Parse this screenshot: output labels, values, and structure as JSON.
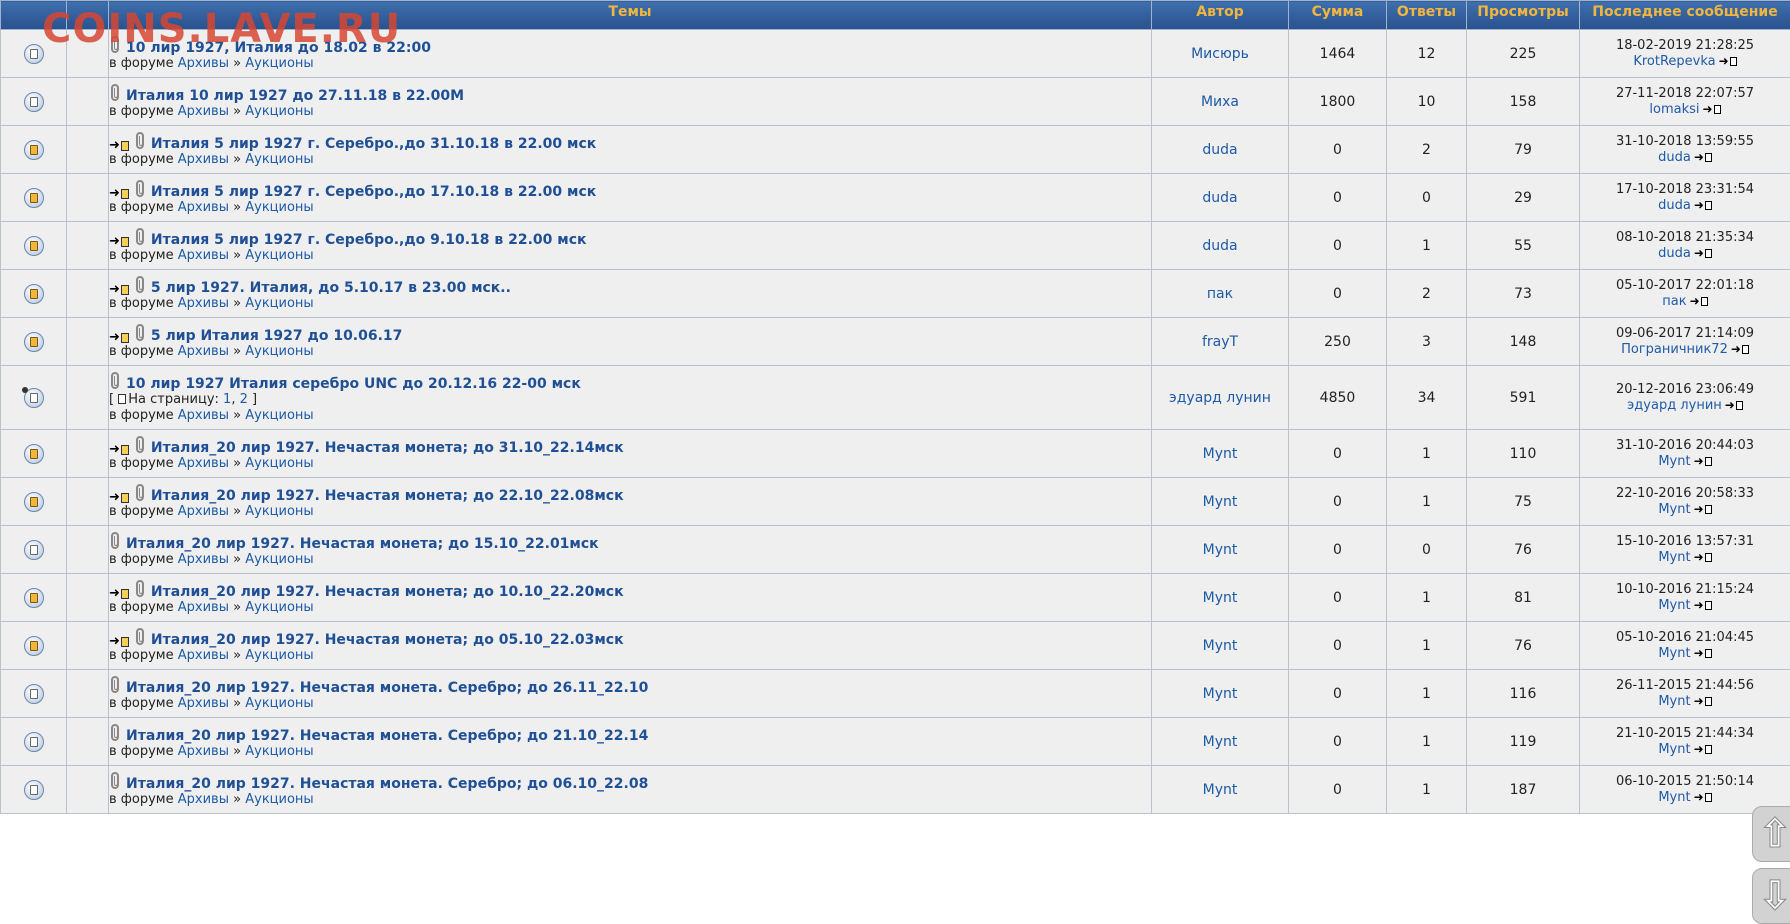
{
  "watermark": "COINS.LAVE.RU",
  "headers": {
    "topics": "Темы",
    "author": "Автор",
    "sum": "Сумма",
    "replies": "Ответы",
    "views": "Просмотры",
    "last": "Последнее сообщение"
  },
  "labels": {
    "in_forum": "в форуме",
    "separator": "»",
    "pages_prefix": "На страницу:"
  },
  "rows": [
    {
      "title": "10 лир 1927, Италия до 18.02 в 22:00",
      "new": false,
      "icon": "cold",
      "forum": "Архивы",
      "subforum": "Аукционы",
      "author": "Мисюрь",
      "sum": "1464",
      "replies": "12",
      "views": "225",
      "last_date": "18-02-2019 21:28:25",
      "last_user": "KrotRepevka"
    },
    {
      "title": "Италия 10 лир 1927 до 27.11.18 в 22.00М",
      "new": false,
      "icon": "cold",
      "forum": "Архивы",
      "subforum": "Аукционы",
      "author": "Миха",
      "sum": "1800",
      "replies": "10",
      "views": "158",
      "last_date": "27-11-2018 22:07:57",
      "last_user": "lomaksi"
    },
    {
      "title": "Италия 5 лир 1927 г. Серебро.,до 31.10.18 в 22.00 мск",
      "new": true,
      "icon": "hot",
      "forum": "Архивы",
      "subforum": "Аукционы",
      "author": "duda",
      "sum": "0",
      "replies": "2",
      "views": "79",
      "last_date": "31-10-2018 13:59:55",
      "last_user": "duda"
    },
    {
      "title": "Италия 5 лир 1927 г. Серебро.,до 17.10.18 в 22.00 мск",
      "new": true,
      "icon": "hot",
      "forum": "Архивы",
      "subforum": "Аукционы",
      "author": "duda",
      "sum": "0",
      "replies": "0",
      "views": "29",
      "last_date": "17-10-2018 23:31:54",
      "last_user": "duda"
    },
    {
      "title": "Италия 5 лир 1927 г. Серебро.,до 9.10.18 в 22.00 мск",
      "new": true,
      "icon": "hot",
      "forum": "Архивы",
      "subforum": "Аукционы",
      "author": "duda",
      "sum": "0",
      "replies": "1",
      "views": "55",
      "last_date": "08-10-2018 21:35:34",
      "last_user": "duda"
    },
    {
      "title": "5 лир 1927. Италия, до 5.10.17 в 23.00 мск..",
      "new": true,
      "icon": "hot",
      "forum": "Архивы",
      "subforum": "Аукционы",
      "author": "пак",
      "sum": "0",
      "replies": "2",
      "views": "73",
      "last_date": "05-10-2017 22:01:18",
      "last_user": "пак"
    },
    {
      "title": "5 лир Италия 1927 до 10.06.17",
      "new": true,
      "icon": "hot",
      "forum": "Архивы",
      "subforum": "Аукционы",
      "author": "frayT",
      "sum": "250",
      "replies": "3",
      "views": "148",
      "last_date": "09-06-2017 21:14:09",
      "last_user": "Пограничник72"
    },
    {
      "title": "10 лир 1927 Италия серебро UNC до 20.12.16 22-00 мск",
      "new": false,
      "icon": "cold dot",
      "forum": "Архивы",
      "subforum": "Аукционы",
      "author": "эдуард лунин",
      "sum": "4850",
      "replies": "34",
      "views": "591",
      "last_date": "20-12-2016 23:06:49",
      "last_user": "эдуард лунин",
      "pages": [
        "1",
        "2"
      ]
    },
    {
      "title": "Италия_20 лир 1927. Нечастая монета; до 31.10_22.14мск",
      "new": true,
      "icon": "hot",
      "forum": "Архивы",
      "subforum": "Аукционы",
      "author": "Mynt",
      "sum": "0",
      "replies": "1",
      "views": "110",
      "last_date": "31-10-2016 20:44:03",
      "last_user": "Mynt"
    },
    {
      "title": "Италия_20 лир 1927. Нечастая монета; до 22.10_22.08мск",
      "new": true,
      "icon": "hot",
      "forum": "Архивы",
      "subforum": "Аукционы",
      "author": "Mynt",
      "sum": "0",
      "replies": "1",
      "views": "75",
      "last_date": "22-10-2016 20:58:33",
      "last_user": "Mynt"
    },
    {
      "title": "Италия_20 лир 1927. Нечастая монета; до 15.10_22.01мск",
      "new": false,
      "icon": "cold",
      "forum": "Архивы",
      "subforum": "Аукционы",
      "author": "Mynt",
      "sum": "0",
      "replies": "0",
      "views": "76",
      "last_date": "15-10-2016 13:57:31",
      "last_user": "Mynt"
    },
    {
      "title": "Италия_20 лир 1927. Нечастая монета; до 10.10_22.20мск",
      "new": true,
      "icon": "hot",
      "forum": "Архивы",
      "subforum": "Аукционы",
      "author": "Mynt",
      "sum": "0",
      "replies": "1",
      "views": "81",
      "last_date": "10-10-2016 21:15:24",
      "last_user": "Mynt"
    },
    {
      "title": "Италия_20 лир 1927. Нечастая монета; до 05.10_22.03мск",
      "new": true,
      "icon": "hot",
      "forum": "Архивы",
      "subforum": "Аукционы",
      "author": "Mynt",
      "sum": "0",
      "replies": "1",
      "views": "76",
      "last_date": "05-10-2016 21:04:45",
      "last_user": "Mynt"
    },
    {
      "title": "Италия_20 лир 1927. Нечастая монета. Серебро; до 26.11_22.10",
      "new": false,
      "icon": "cold",
      "forum": "Архивы",
      "subforum": "Аукционы",
      "author": "Mynt",
      "sum": "0",
      "replies": "1",
      "views": "116",
      "last_date": "26-11-2015 21:44:56",
      "last_user": "Mynt"
    },
    {
      "title": "Италия_20 лир 1927. Нечастая монета. Серебро; до 21.10_22.14",
      "new": false,
      "icon": "cold",
      "forum": "Архивы",
      "subforum": "Аукционы",
      "author": "Mynt",
      "sum": "0",
      "replies": "1",
      "views": "119",
      "last_date": "21-10-2015 21:44:34",
      "last_user": "Mynt"
    },
    {
      "title": "Италия_20 лир 1927. Нечастая монета. Серебро; до 06.10_22.08",
      "new": false,
      "icon": "cold",
      "forum": "Архивы",
      "subforum": "Аукционы",
      "author": "Mynt",
      "sum": "0",
      "replies": "1",
      "views": "187",
      "last_date": "06-10-2015 21:50:14",
      "last_user": "Mynt"
    }
  ],
  "scroll": {
    "up": "⇧",
    "down": "⇩"
  }
}
